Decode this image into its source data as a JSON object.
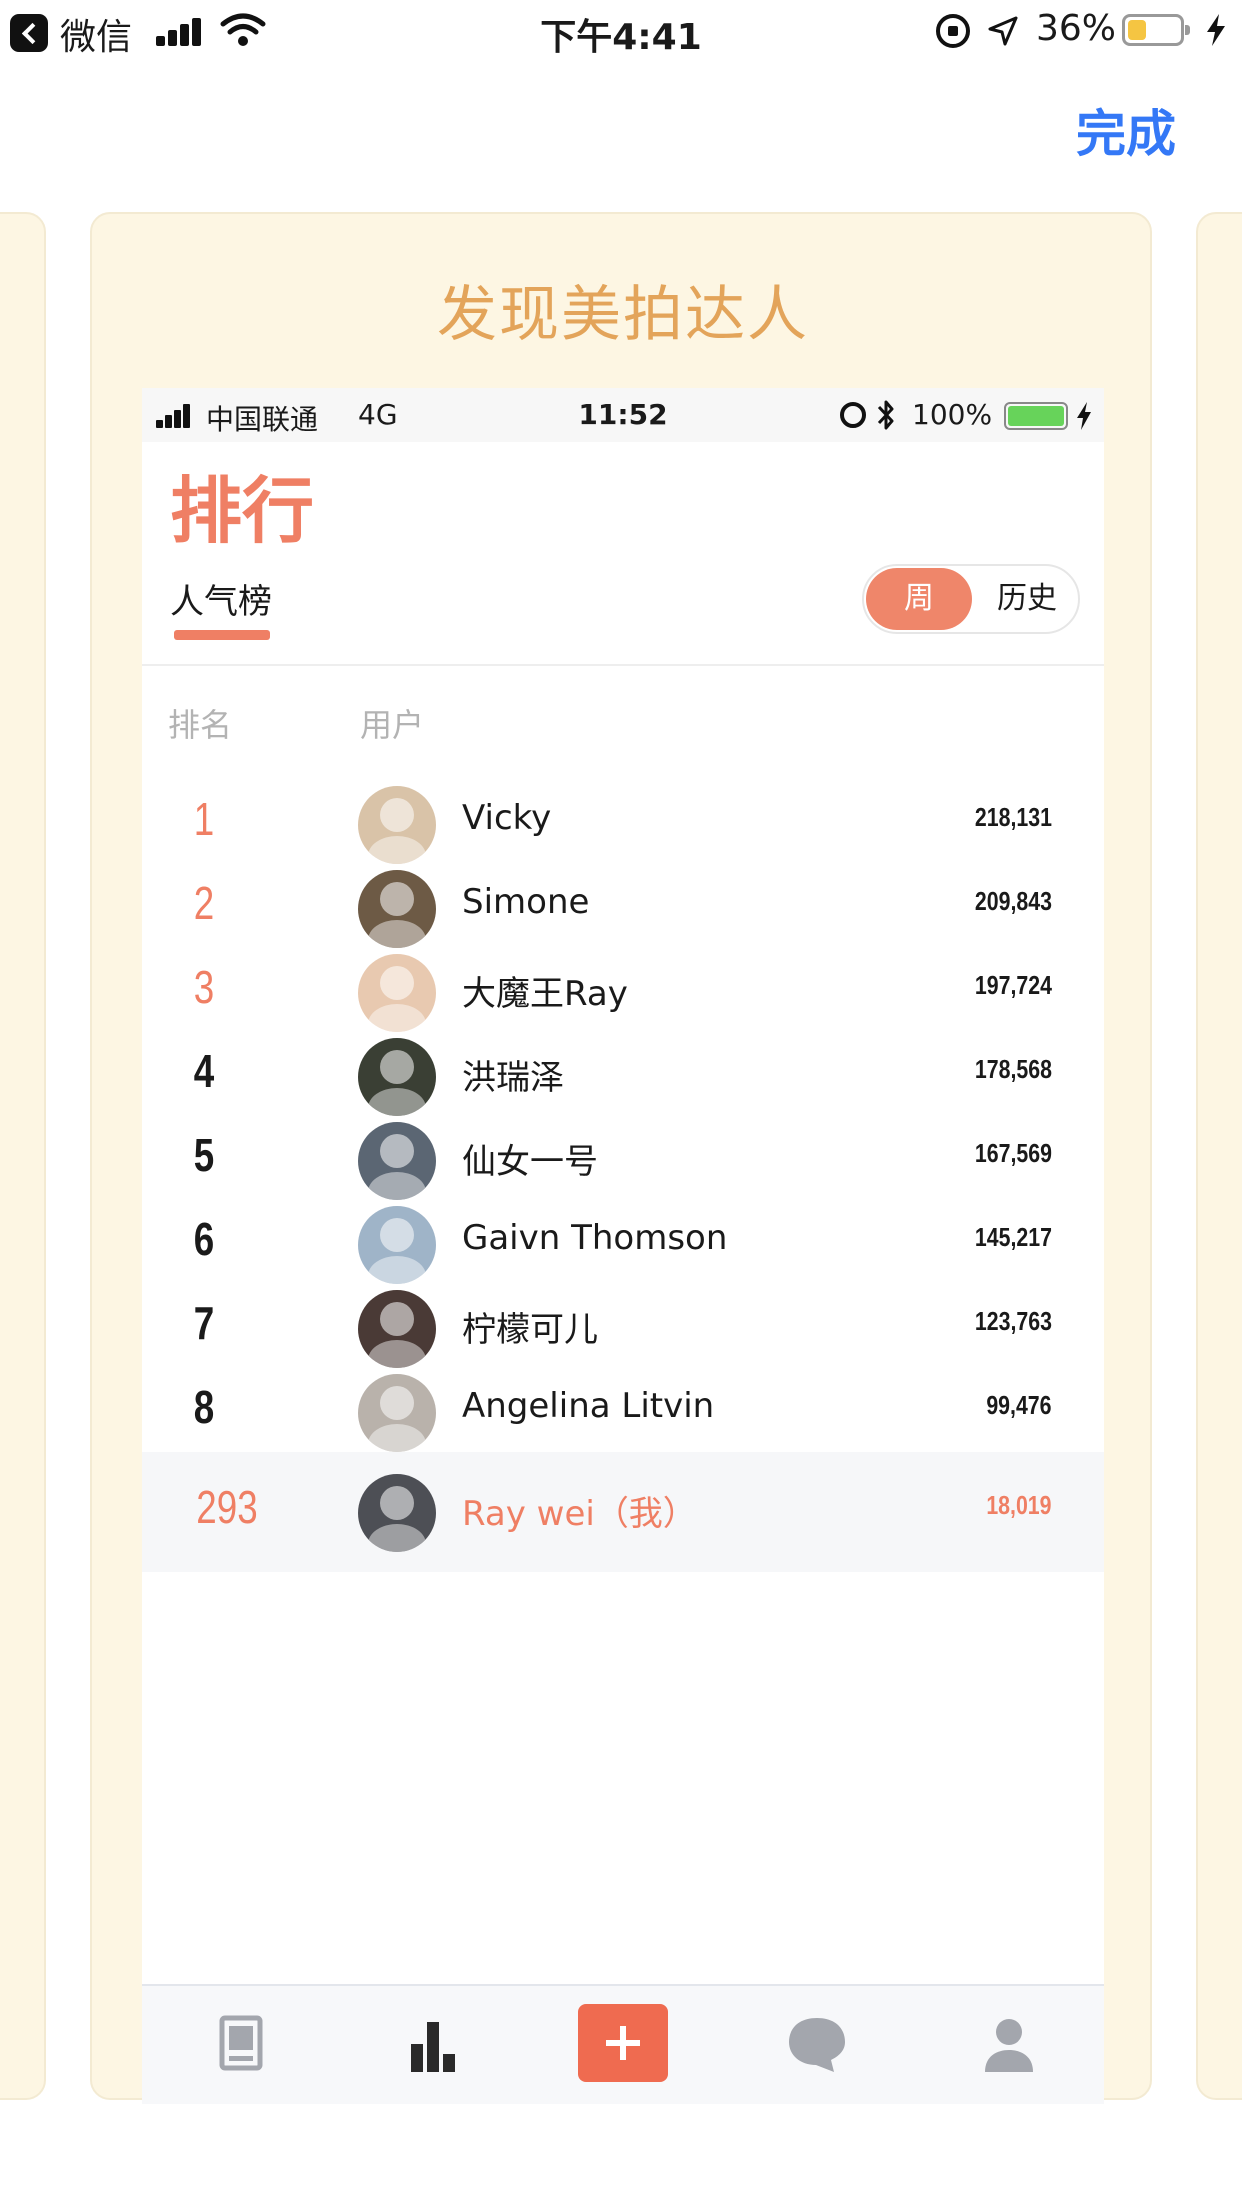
{
  "status_bar": {
    "app": "微信",
    "time": "下午4:41",
    "battery_pct": "36%",
    "battery_level": 0.36,
    "icons": [
      "back-icon",
      "signal-icon",
      "wifi-icon",
      "orientation-lock-icon",
      "location-icon",
      "battery-icon",
      "charging-icon"
    ]
  },
  "header": {
    "done_label": "完成"
  },
  "card": {
    "title": "发现美拍达人"
  },
  "inner_status": {
    "carrier": "中国联通",
    "network": "4G",
    "time": "11:52",
    "battery_pct": "100%",
    "battery_level": 1.0,
    "icons": [
      "signal-icon",
      "alarm-icon",
      "bluetooth-icon",
      "battery-icon",
      "charging-icon"
    ]
  },
  "page": {
    "title": "排行",
    "tab": "人气榜",
    "segment": {
      "selected": "周",
      "other": "历史"
    },
    "columns": {
      "rank": "排名",
      "user": "用户"
    }
  },
  "accent_color": "#ef7f64",
  "rows": [
    {
      "rank": "1",
      "name": "Vicky",
      "score": "218,131",
      "avatar_color": "#d9c3a8"
    },
    {
      "rank": "2",
      "name": "Simone",
      "score": "209,843",
      "avatar_color": "#6d5a45"
    },
    {
      "rank": "3",
      "name": "大魔王Ray",
      "score": "197,724",
      "avatar_color": "#e8c9b0"
    },
    {
      "rank": "4",
      "name": "洪瑞泽",
      "score": "178,568",
      "avatar_color": "#3a3f34"
    },
    {
      "rank": "5",
      "name": "仙女一号",
      "score": "167,569",
      "avatar_color": "#5b6673"
    },
    {
      "rank": "6",
      "name": "Gaivn Thomson",
      "score": "145,217",
      "avatar_color": "#9fb4c8"
    },
    {
      "rank": "7",
      "name": "柠檬可儿",
      "score": "123,763",
      "avatar_color": "#4a3a36"
    },
    {
      "rank": "8",
      "name": "Angelina Litvin",
      "score": "99,476",
      "avatar_color": "#b9b2ab"
    }
  ],
  "me": {
    "rank": "293",
    "name": "Ray wei（我）",
    "score": "18,019",
    "avatar_color": "#4d4f55"
  },
  "tabbar": {
    "items": [
      "discover-icon",
      "rank-icon",
      "add-icon",
      "message-icon",
      "profile-icon"
    ],
    "selected": "rank-icon"
  }
}
